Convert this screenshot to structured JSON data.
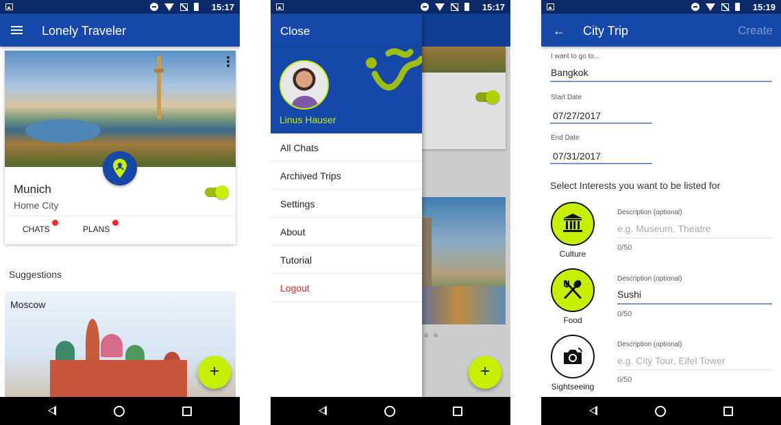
{
  "status_bar": {
    "screen1_time": "15:17",
    "screen2_time": "15:17",
    "screen3_time": "15:19"
  },
  "screen1": {
    "app_title": "Lonely Traveler",
    "home_card": {
      "city_name": "Munich",
      "subtitle": "Home City",
      "toggle_on": true,
      "chats_label": "CHATS",
      "plans_label": "PLANS"
    },
    "suggestions_title": "Suggestions",
    "suggestion_city": "Moscow",
    "fab_icon": "+"
  },
  "screen2": {
    "close_label": "Close",
    "user_name": "Linus Hauser",
    "menu_items": [
      "All Chats",
      "Archived Trips",
      "Settings",
      "About",
      "Tutorial"
    ],
    "logout_label": "Logout",
    "fab_icon": "+"
  },
  "screen3": {
    "title": "City Trip",
    "create_label": "Create",
    "destination": {
      "label": "I want to go to...",
      "value": "Bangkok"
    },
    "start_date": {
      "label": "Start Date",
      "value": "07/27/2017"
    },
    "end_date": {
      "label": "End Date",
      "value": "07/31/2017"
    },
    "interests_prompt": "Select Interests you want to be listed for",
    "interests": [
      {
        "name": "Culture",
        "icon": "museum-icon",
        "selected": true,
        "desc_label": "Description (optional)",
        "desc_placeholder": "e.g. Museum, Theatre",
        "desc_value": "",
        "counter": "0/50"
      },
      {
        "name": "Food",
        "icon": "fork-spoon-icon",
        "selected": true,
        "desc_label": "Description (optional)",
        "desc_placeholder": "",
        "desc_value": "Sushi",
        "counter": "0/50"
      },
      {
        "name": "Sightseeing",
        "icon": "camera-icon",
        "selected": false,
        "desc_label": "Description (optional)",
        "desc_placeholder": "e.g. City Tour, Eifel Tower",
        "desc_value": "",
        "counter": "0/50"
      }
    ]
  },
  "colors": {
    "primary": "#1548a8",
    "status_bar": "#0b2a6a",
    "accent": "#c6f000",
    "logout": "#e3262a",
    "notification_dot": "#f22a2a"
  }
}
